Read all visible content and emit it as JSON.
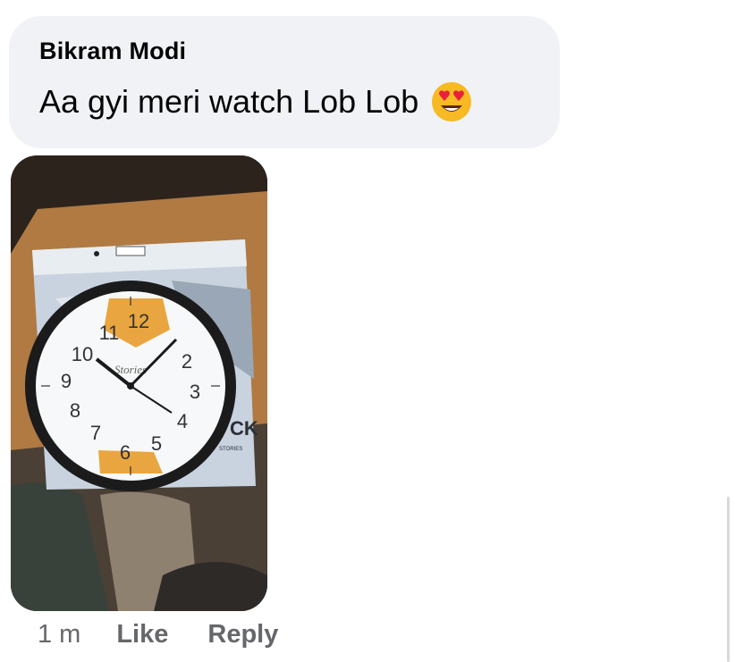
{
  "comment": {
    "author": "Bikram Modi",
    "text": "Aa gyi meri watch Lob Lob",
    "emoji_icon": "heart-eyes-emoji-icon"
  },
  "photo": {
    "clock_numbers": [
      "12",
      "2",
      "3",
      "4",
      "5",
      "6",
      "7",
      "8",
      "9",
      "10",
      "11"
    ],
    "clock_brand": "Stories",
    "box_label": "CK",
    "box_sublabel": "STORIES"
  },
  "actions": {
    "time": "1 m",
    "like": "Like",
    "reply": "Reply"
  },
  "colors": {
    "bubble": "#f0f2f5",
    "meta_text": "#65676b",
    "clock_frame": "#1b1b1b",
    "clock_accent": "#e9a640"
  }
}
